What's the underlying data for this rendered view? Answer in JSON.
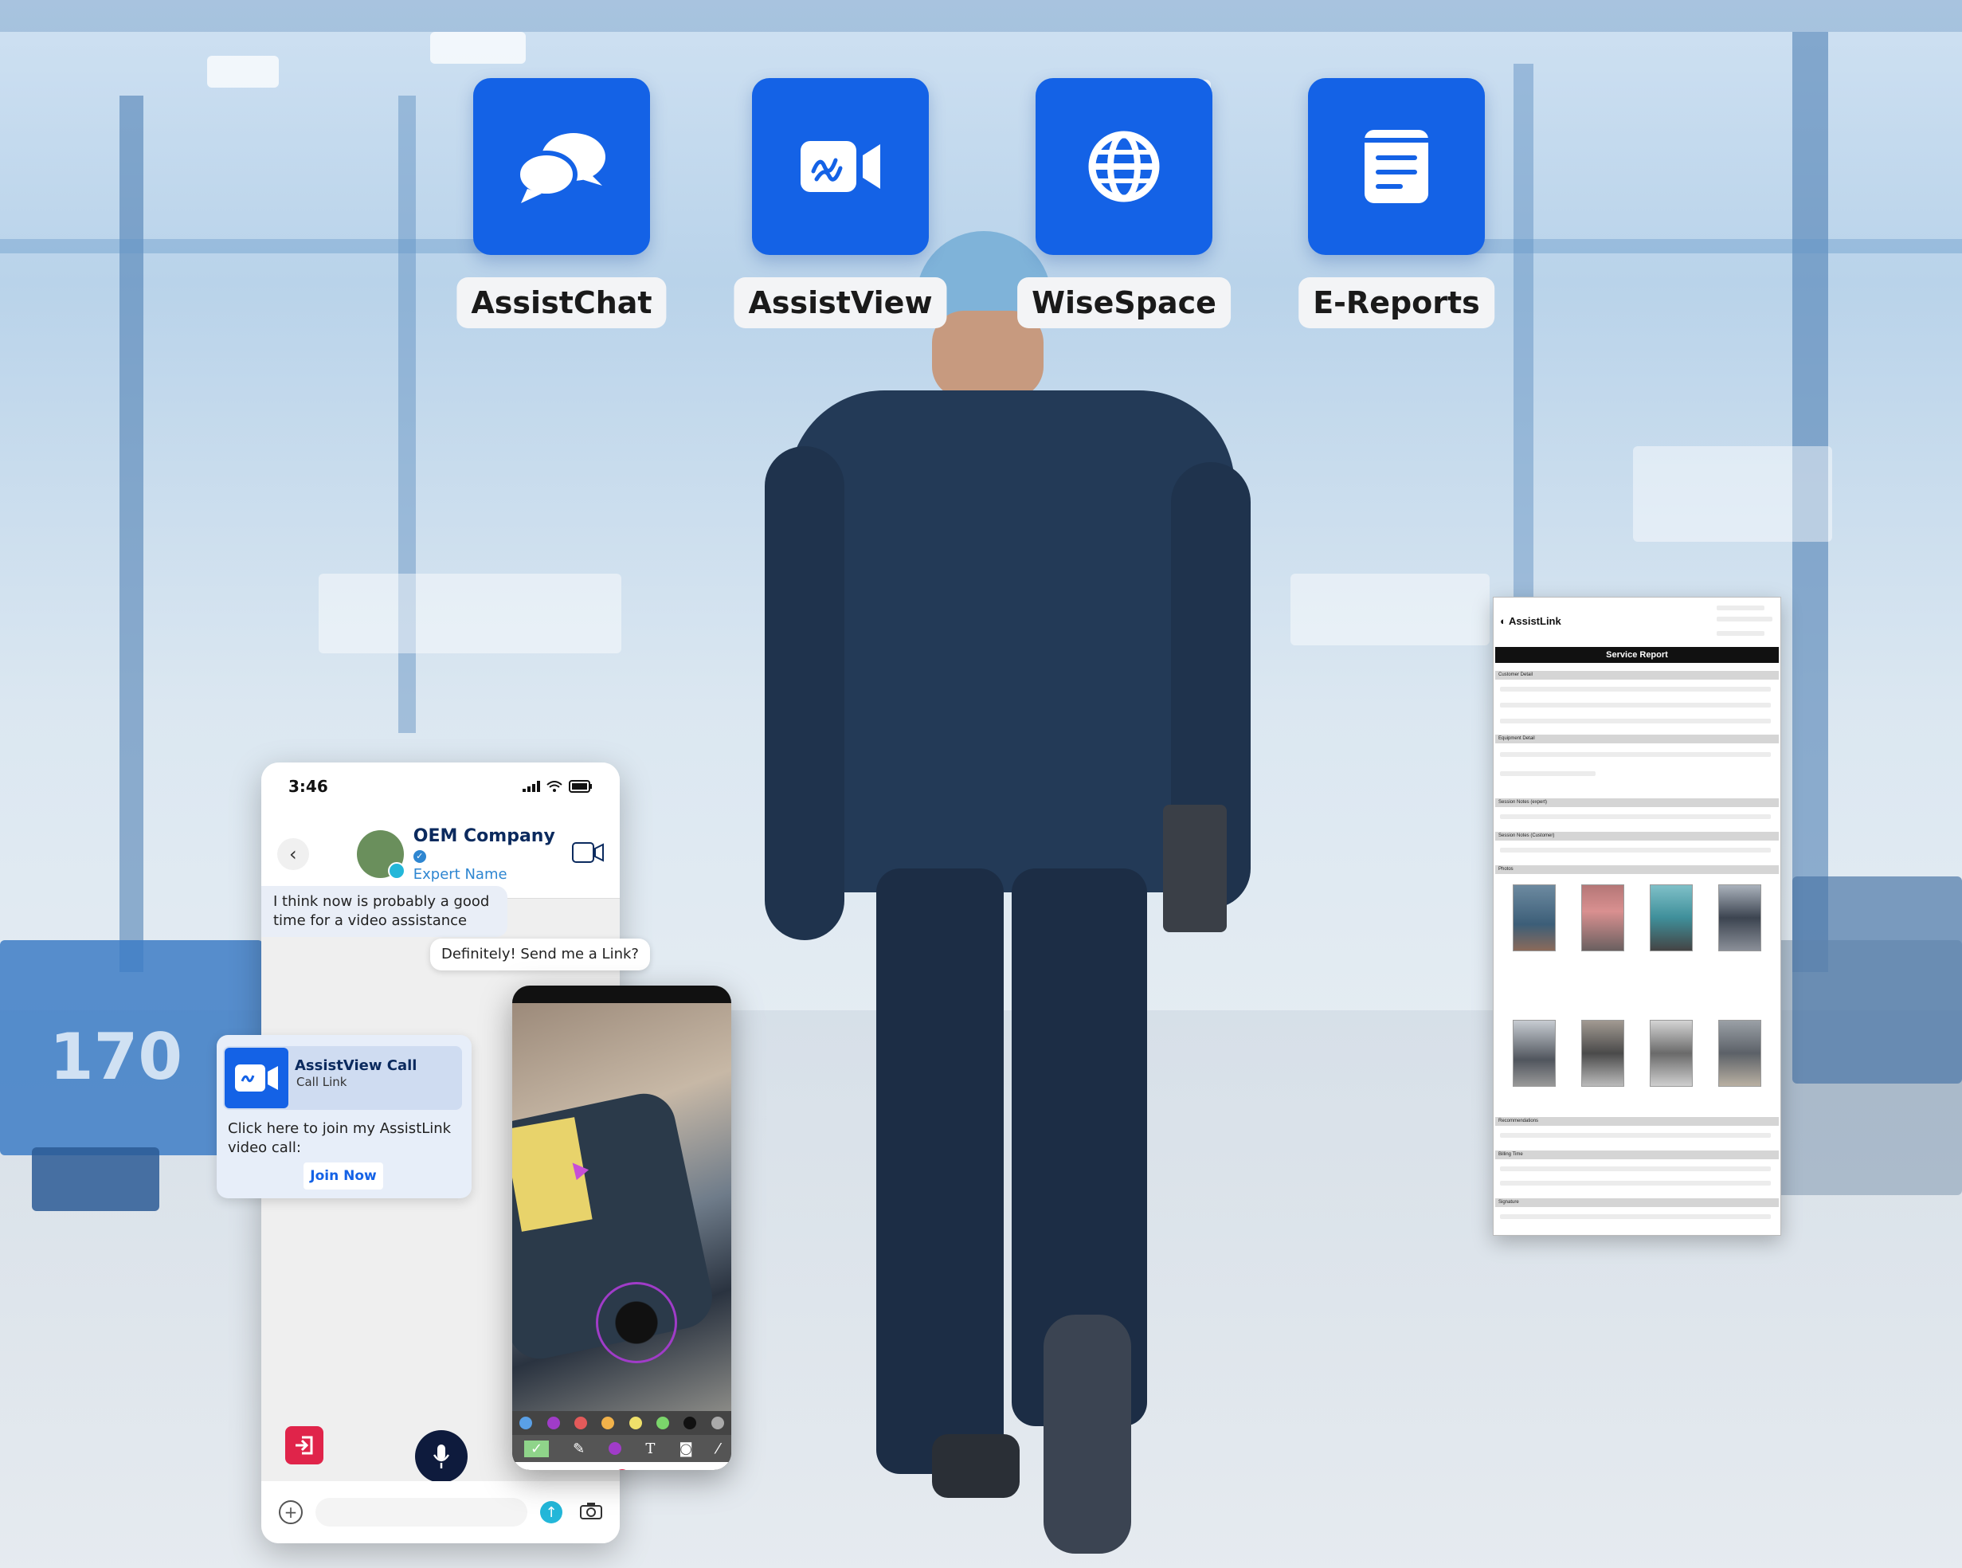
{
  "apps": [
    {
      "label": "AssistChat",
      "icon": "chat-bubbles-icon"
    },
    {
      "label": "AssistView",
      "icon": "video-camera-icon"
    },
    {
      "label": "WiseSpace",
      "icon": "globe-icon"
    },
    {
      "label": "E-Reports",
      "icon": "document-icon"
    }
  ],
  "background": {
    "machine_number": "170"
  },
  "phone": {
    "time": "3:46",
    "contact_name": "OEM Company",
    "contact_subtitle": "Expert Name",
    "messages": [
      {
        "from": "them",
        "text": "I think now is probably a good time for a video assistance"
      },
      {
        "from": "me",
        "text": "Definitely! Send me a Link?"
      }
    ],
    "call_card": {
      "title": "AssistView Call",
      "subtitle": "Call Link",
      "body": "Click here to join my AssistLink video call:",
      "button": "Join Now"
    }
  },
  "report": {
    "brand": "AssistLink",
    "title": "Service Report",
    "sections": [
      "Customer Detail",
      "Equipment Detail",
      "Session Notes (expert)",
      "Session Notes (Customer)",
      "Photos",
      "Recommendations",
      "Billing Time",
      "Signature"
    ]
  },
  "colors": {
    "brand_blue": "#1462e6",
    "navy": "#0b2a5e",
    "accent_cyan": "#23b7d9",
    "exit_red": "#e0244a"
  }
}
